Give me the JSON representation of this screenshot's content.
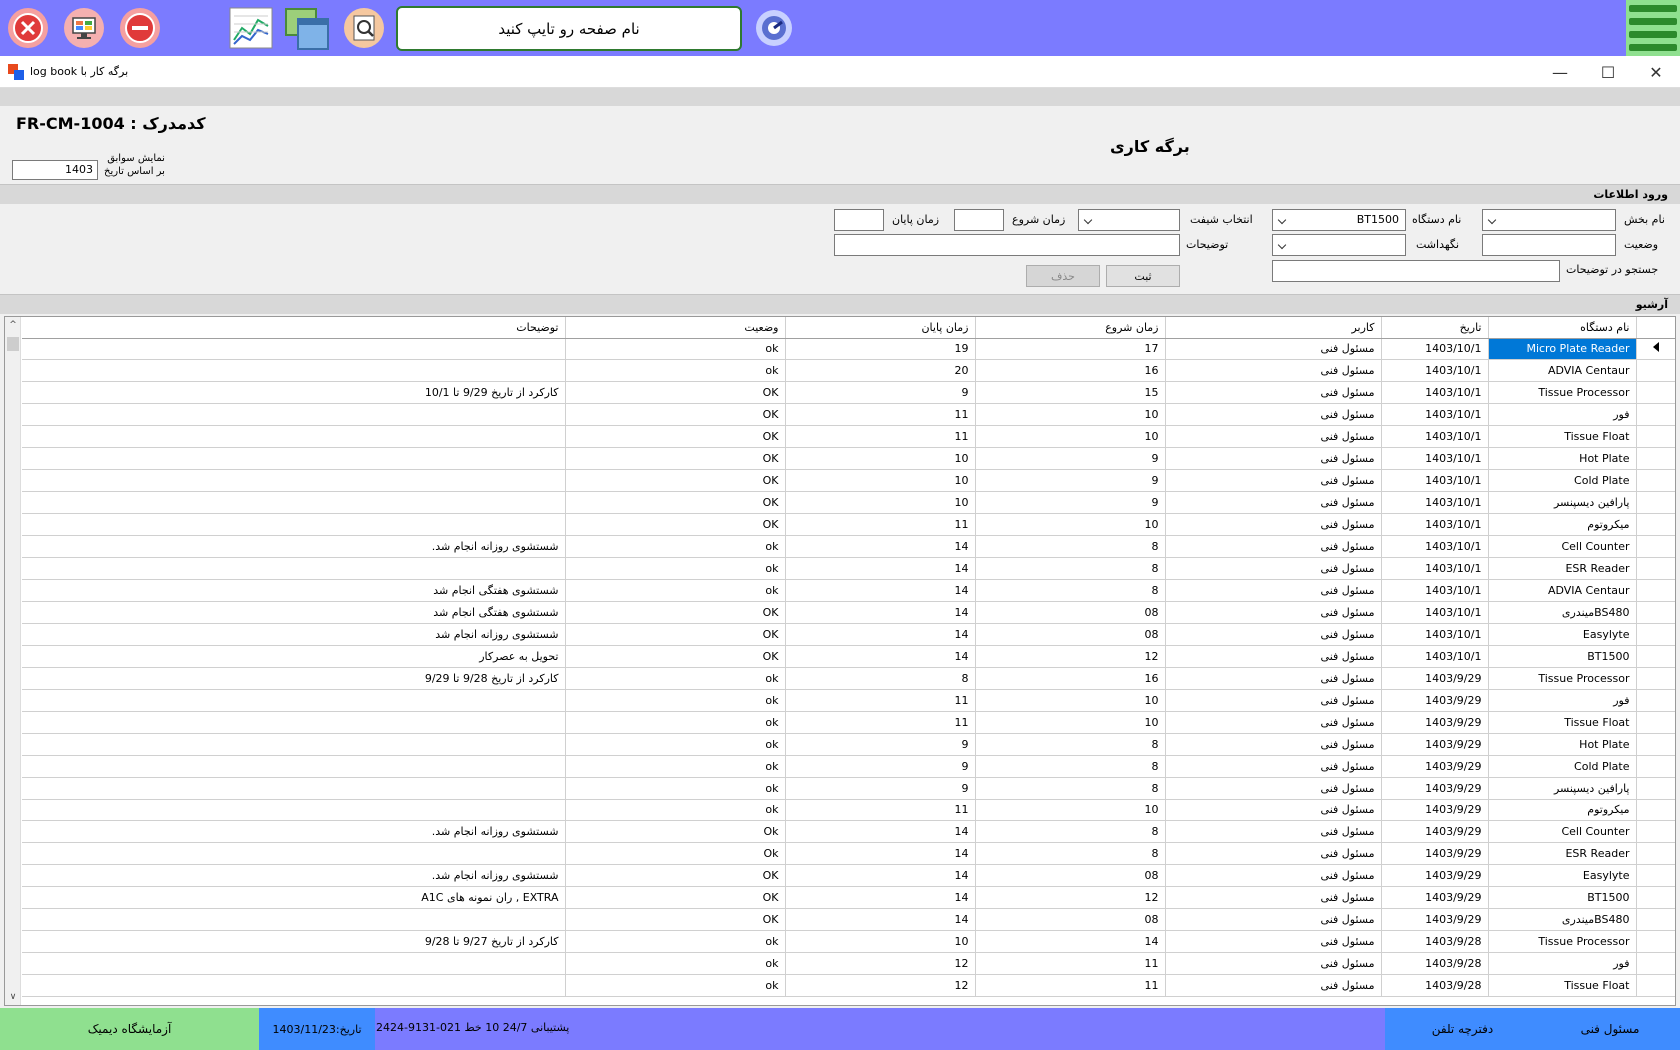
{
  "toolbar": {
    "search_placeholder": "نام صفحه رو تایپ کنید",
    "icons": [
      "close-circle-icon",
      "monitor-icon",
      "minus-circle-icon",
      "chart-icon",
      "windows-icon",
      "search-doc-icon",
      "settings-dial-icon",
      "hamburger-menu-icon"
    ],
    "colors": {
      "bar": "#7b7bff",
      "green": "#8fe08f"
    }
  },
  "window": {
    "title": "log book برگه کار با"
  },
  "header": {
    "code": "FR-CM-1004 : کدمدرک",
    "title": "برگه کاری",
    "history_label_1": "نمایش سوابق",
    "history_label_2": "بر اساس تاریخ",
    "history_year": "1403"
  },
  "form": {
    "section": "ورود اطلاعات",
    "section_label": "نام بخش",
    "device_label": "نام دستگاه",
    "device_value": "BT1500",
    "shift_label": "انتخاب شیفت",
    "start_label": "زمان شروع",
    "end_label": "زمان پایان",
    "status_label": "وضعیت",
    "maintenance_label": "نگهداشت",
    "notes_label": "توضیحات",
    "search_notes_label": "جستجو در توضیحات",
    "save_button": "ثبت",
    "delete_button": "حذف"
  },
  "archive": {
    "section": "آرشیو",
    "columns": [
      "نام دستگاه",
      "تاریخ",
      "کاربر",
      "زمان شروع",
      "زمان پایان",
      "وضعیت",
      "توضیحات"
    ],
    "rows": [
      [
        "Micro Plate Reader",
        "1403/10/1",
        "مسئول فنی",
        "17",
        "19",
        "ok",
        ""
      ],
      [
        "ADVIA Centaur",
        "1403/10/1",
        "مسئول فنی",
        "16",
        "20",
        "ok",
        ""
      ],
      [
        "Tissue Processor",
        "1403/10/1",
        "مسئول فنی",
        "15",
        "9",
        "OK",
        "کارکرد از تاریخ 9/29 تا 10/1"
      ],
      [
        "فور",
        "1403/10/1",
        "مسئول فنی",
        "10",
        "11",
        "OK",
        ""
      ],
      [
        "Tissue Float",
        "1403/10/1",
        "مسئول فنی",
        "10",
        "11",
        "OK",
        ""
      ],
      [
        "Hot Plate",
        "1403/10/1",
        "مسئول فنی",
        "9",
        "10",
        "OK",
        ""
      ],
      [
        "Cold Plate",
        "1403/10/1",
        "مسئول فنی",
        "9",
        "10",
        "OK",
        ""
      ],
      [
        "پارافین دیسپنسر",
        "1403/10/1",
        "مسئول فنی",
        "9",
        "10",
        "OK",
        ""
      ],
      [
        "میکروتوم",
        "1403/10/1",
        "مسئول فنی",
        "10",
        "11",
        "OK",
        ""
      ],
      [
        "Cell Counter",
        "1403/10/1",
        "مسئول فنی",
        "8",
        "14",
        "ok",
        "شستشوی روزانه انجام شد."
      ],
      [
        "ESR Reader",
        "1403/10/1",
        "مسئول فنی",
        "8",
        "14",
        "ok",
        ""
      ],
      [
        "ADVIA Centaur",
        "1403/10/1",
        "مسئول فنی",
        "8",
        "14",
        "ok",
        "شستشوی هفتگی انجام شد"
      ],
      [
        "BS480میندری",
        "1403/10/1",
        "مسئول فنی",
        "08",
        "14",
        "OK",
        "شستشوی هفتگی انجام شد"
      ],
      [
        "Easylyte",
        "1403/10/1",
        "مسئول فنی",
        "08",
        "14",
        "OK",
        "شستشوی روزانه انجام شد"
      ],
      [
        "BT1500",
        "1403/10/1",
        "مسئول فنی",
        "12",
        "14",
        "OK",
        "تحویل به عصرکار"
      ],
      [
        "Tissue Processor",
        "1403/9/29",
        "مسئول فنی",
        "16",
        "8",
        "ok",
        "کارکرد از تاریخ 9/28 تا 9/29"
      ],
      [
        "فور",
        "1403/9/29",
        "مسئول فنی",
        "10",
        "11",
        "ok",
        ""
      ],
      [
        "Tissue Float",
        "1403/9/29",
        "مسئول فنی",
        "10",
        "11",
        "ok",
        ""
      ],
      [
        "Hot Plate",
        "1403/9/29",
        "مسئول فنی",
        "8",
        "9",
        "ok",
        ""
      ],
      [
        "Cold Plate",
        "1403/9/29",
        "مسئول فنی",
        "8",
        "9",
        "ok",
        ""
      ],
      [
        "پارافین دیسپنسر",
        "1403/9/29",
        "مسئول فنی",
        "8",
        "9",
        "ok",
        ""
      ],
      [
        "میکروتوم",
        "1403/9/29",
        "مسئول فنی",
        "10",
        "11",
        "ok",
        ""
      ],
      [
        "Cell Counter",
        "1403/9/29",
        "مسئول فنی",
        "8",
        "14",
        "Ok",
        "شستشوی روزانه انجام شد."
      ],
      [
        "ESR Reader",
        "1403/9/29",
        "مسئول فنی",
        "8",
        "14",
        "Ok",
        ""
      ],
      [
        "Easylyte",
        "1403/9/29",
        "مسئول فنی",
        "08",
        "14",
        "OK",
        "شستشوی روزانه انجام شد."
      ],
      [
        "BT1500",
        "1403/9/29",
        "مسئول فنی",
        "12",
        "14",
        "OK",
        "EXTRA , ران نمونه های A1C"
      ],
      [
        "BS480میندری",
        "1403/9/29",
        "مسئول فنی",
        "08",
        "14",
        "OK",
        ""
      ],
      [
        "Tissue Processor",
        "1403/9/28",
        "مسئول فنی",
        "14",
        "10",
        "ok",
        "کارکرد از تاریخ 9/27 تا 9/28"
      ],
      [
        "فور",
        "1403/9/28",
        "مسئول فنی",
        "11",
        "12",
        "ok",
        ""
      ],
      [
        "Tissue Float",
        "1403/9/28",
        "مسئول فنی",
        "11",
        "12",
        "ok",
        ""
      ]
    ]
  },
  "status": {
    "lab": "آزمایشگاه دیمیک",
    "date": "تاریخ:1403/11/23",
    "support": "پشتیبانی 24/7    10 خط  021-9131-2424",
    "phonebook": "دفترچه تلفن",
    "user": "مسئول فنی"
  }
}
